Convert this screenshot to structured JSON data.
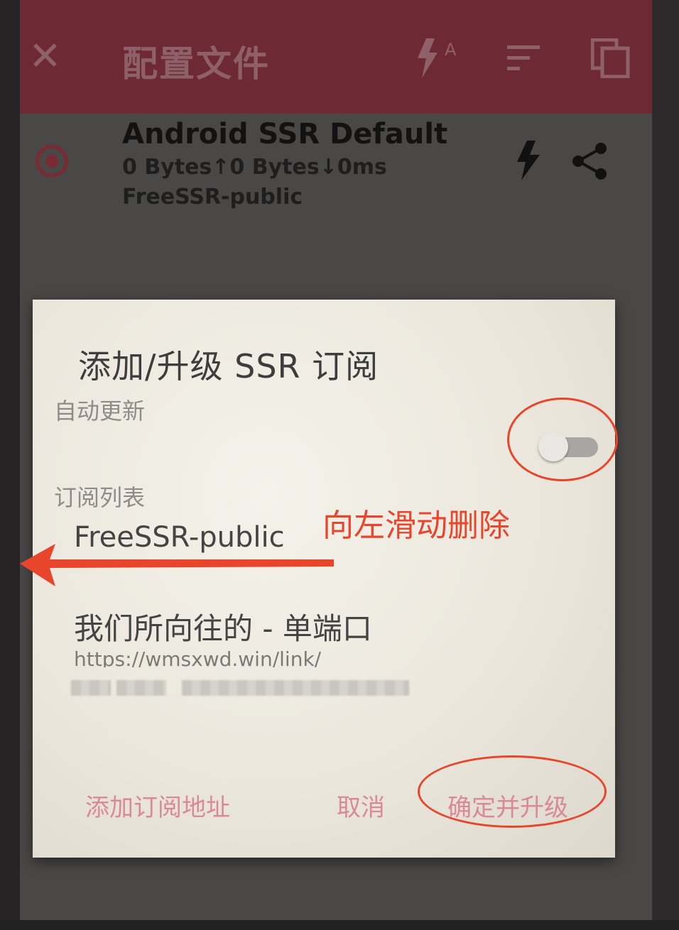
{
  "toolbar": {
    "title": "配置文件",
    "icons": [
      "close-icon",
      "test-latency-icon",
      "sort-icon",
      "copy-icon"
    ],
    "color": "#6e2a34"
  },
  "profile": {
    "name": "Android SSR Default",
    "stats": "0 Bytes↑0 Bytes↓0ms",
    "group": "FreeSSR-public",
    "selected": true
  },
  "dialog": {
    "title": "添加/升级 SSR 订阅",
    "auto_update_label": "自动更新",
    "auto_update_on": false,
    "subscription_list_label": "订阅列表",
    "subscriptions": [
      {
        "name": "FreeSSR-public"
      },
      {
        "name": "我们所向往的 - 单端口",
        "url": "https://wmsxwd.win/link/"
      }
    ],
    "buttons": {
      "add": "添加订阅地址",
      "cancel": "取消",
      "confirm": "确定并升级"
    },
    "accent_color": "#d98a94"
  },
  "annotations": {
    "swipe_hint": "向左滑动删除",
    "color": "#e8462c"
  }
}
